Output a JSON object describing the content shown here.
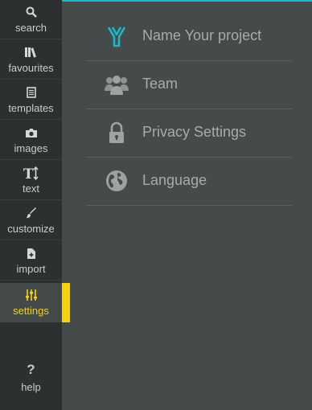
{
  "sidebar": {
    "items": [
      {
        "label": "search",
        "icon": "search-icon"
      },
      {
        "label": "favourites",
        "icon": "books-icon"
      },
      {
        "label": "templates",
        "icon": "document-icon"
      },
      {
        "label": "images",
        "icon": "camera-icon"
      },
      {
        "label": "text",
        "icon": "text-size-icon"
      },
      {
        "label": "customize",
        "icon": "brush-icon"
      },
      {
        "label": "import",
        "icon": "file-plus-icon"
      },
      {
        "label": "settings",
        "icon": "sliders-icon",
        "active": true
      }
    ],
    "help": {
      "symbol": "?",
      "label": "help"
    }
  },
  "settings_menu": {
    "items": [
      {
        "label": "Name Your project",
        "icon": "project-logo-icon"
      },
      {
        "label": "Team",
        "icon": "team-icon"
      },
      {
        "label": "Privacy Settings",
        "icon": "lock-icon"
      },
      {
        "label": "Language",
        "icon": "globe-icon"
      }
    ]
  },
  "colors": {
    "sidebar_bg": "#2c3031",
    "main_bg": "#454a4b",
    "active": "#f5d210",
    "accent": "#1fb7c7",
    "text": "#a6abab"
  }
}
